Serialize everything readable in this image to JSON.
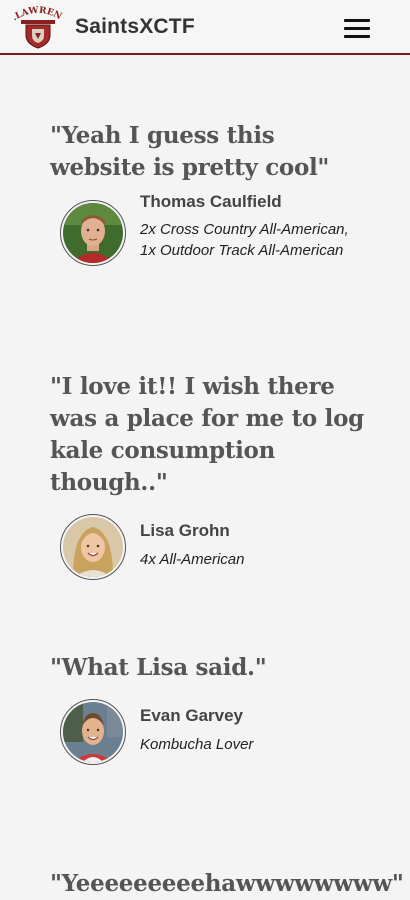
{
  "header": {
    "logo_text": "ST.LAWRENCE",
    "site_name": "SaintsXCTF",
    "menu_icon": "hamburger-menu-icon"
  },
  "testimonials": [
    {
      "quote": "\"Yeah I guess this website is pretty cool\"",
      "name": "Thomas Caulfield",
      "title": "2x Cross Country All-American, 1x Outdoor Track All-American"
    },
    {
      "quote": "\"I love it!! I wish there was a place for me to log kale consumption though..\"",
      "name": "Lisa Grohn",
      "title": "4x All-American"
    },
    {
      "quote": "\"What Lisa said.\"",
      "name": "Evan Garvey",
      "title": "Kombucha Lover"
    },
    {
      "quote": "\"Yeeeeeeeeehawwwwwwww\""
    }
  ],
  "colors": {
    "accent": "#7a1e1e",
    "background": "#f4f4f4",
    "quote_text": "#555555"
  }
}
